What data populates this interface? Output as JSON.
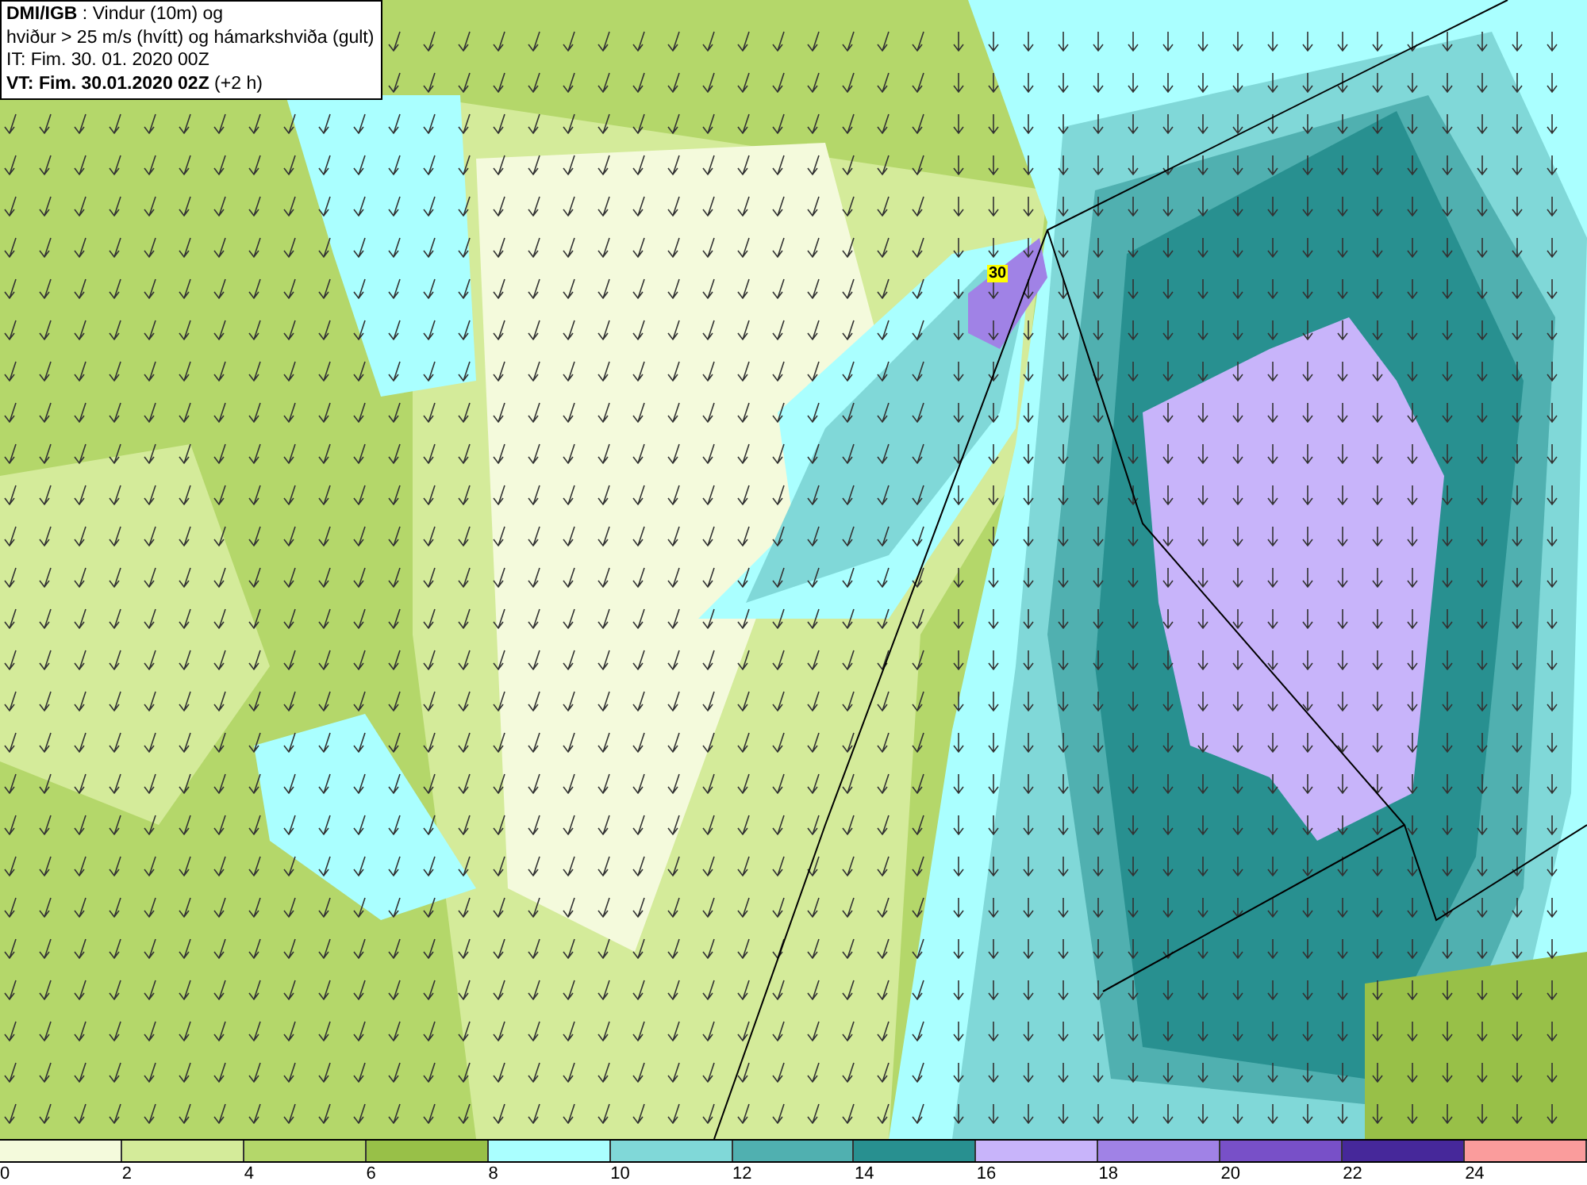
{
  "info_box": {
    "lines": [
      "**DMI/IGB** : Vindur (10m) og",
      "hviður > 25 m/s (hvítt) og hámarkshviða (gult)",
      "IT: Fim. 30. 01. 2020 00Z",
      "**VT: Fim. 30.01.2020 02Z** (+2 h)"
    ]
  },
  "map": {
    "gust_marker": "30"
  },
  "color_scale": {
    "segments": [
      {
        "color": "#f4fadc"
      },
      {
        "color": "#d4eb9a"
      },
      {
        "color": "#b4d76a"
      },
      {
        "color": "#98c048"
      },
      {
        "color": "#aaffff"
      },
      {
        "color": "#80d8d8"
      },
      {
        "color": "#50b0b0"
      },
      {
        "color": "#289090"
      },
      {
        "color": "#c8b4fa"
      },
      {
        "color": "#a082e6"
      },
      {
        "color": "#7850c8"
      },
      {
        "color": "#46289a"
      },
      {
        "color": "#fa9c9c"
      }
    ],
    "labels": [
      "0",
      "2",
      "4",
      "6",
      "8",
      "10",
      "12",
      "14",
      "16",
      "18",
      "20",
      "22",
      "24"
    ]
  }
}
